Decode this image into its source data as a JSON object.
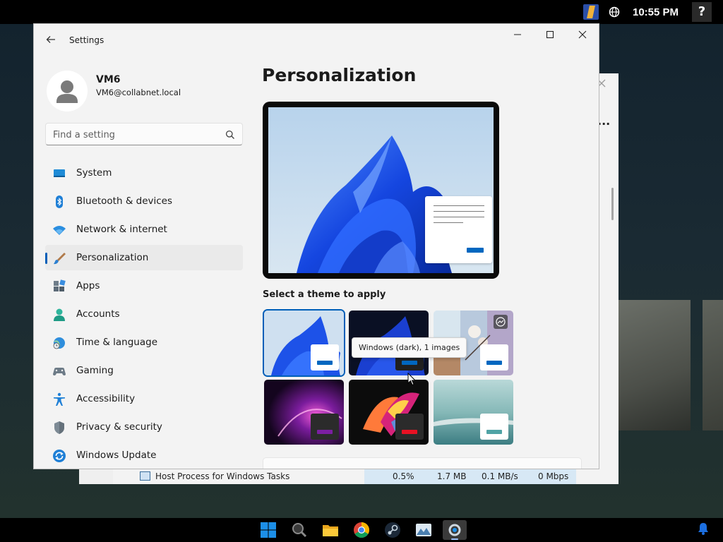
{
  "topbar": {
    "clock": "10:55 PM",
    "help_label": "?",
    "icons": [
      "app-launcher-icon",
      "globe-icon"
    ]
  },
  "background_window": {
    "menu_label": "...",
    "row": {
      "process": "Host Process for Windows Tasks",
      "cpu": "0.5%",
      "memory": "1.7 MB",
      "disk": "0.1 MB/s",
      "network": "0 Mbps"
    }
  },
  "settings": {
    "window_title": "Settings",
    "user": {
      "name": "VM6",
      "email": "VM6@collabnet.local"
    },
    "search": {
      "placeholder": "Find a setting"
    },
    "nav": [
      {
        "label": "System",
        "icon": "system-icon"
      },
      {
        "label": "Bluetooth & devices",
        "icon": "bluetooth-icon"
      },
      {
        "label": "Network & internet",
        "icon": "wifi-icon"
      },
      {
        "label": "Personalization",
        "icon": "brush-icon",
        "active": true
      },
      {
        "label": "Apps",
        "icon": "apps-icon"
      },
      {
        "label": "Accounts",
        "icon": "accounts-icon"
      },
      {
        "label": "Time & language",
        "icon": "time-language-icon"
      },
      {
        "label": "Gaming",
        "icon": "gamepad-icon"
      },
      {
        "label": "Accessibility",
        "icon": "accessibility-icon"
      },
      {
        "label": "Privacy & security",
        "icon": "shield-icon"
      },
      {
        "label": "Windows Update",
        "icon": "update-icon"
      }
    ],
    "page_title": "Personalization",
    "theme_heading": "Select a theme to apply",
    "themes": [
      {
        "id": "windows-light",
        "selected": true,
        "accent": "#0067c0"
      },
      {
        "id": "windows-dark",
        "accent": "#0067c0"
      },
      {
        "id": "spotlight",
        "accent": "#0067c0"
      },
      {
        "id": "glow",
        "accent": "#7b1fa2"
      },
      {
        "id": "captured-motion",
        "accent": "#e81123"
      },
      {
        "id": "flow",
        "accent": "#4fa3a5"
      }
    ],
    "tooltip": "Windows (dark), 1 images",
    "accent_color": "#005fb8"
  },
  "taskbar": {
    "apps": [
      "start-icon",
      "search-icon",
      "file-explorer-icon",
      "chrome-icon",
      "steam-icon",
      "photos-icon",
      "settings-app-icon"
    ]
  }
}
